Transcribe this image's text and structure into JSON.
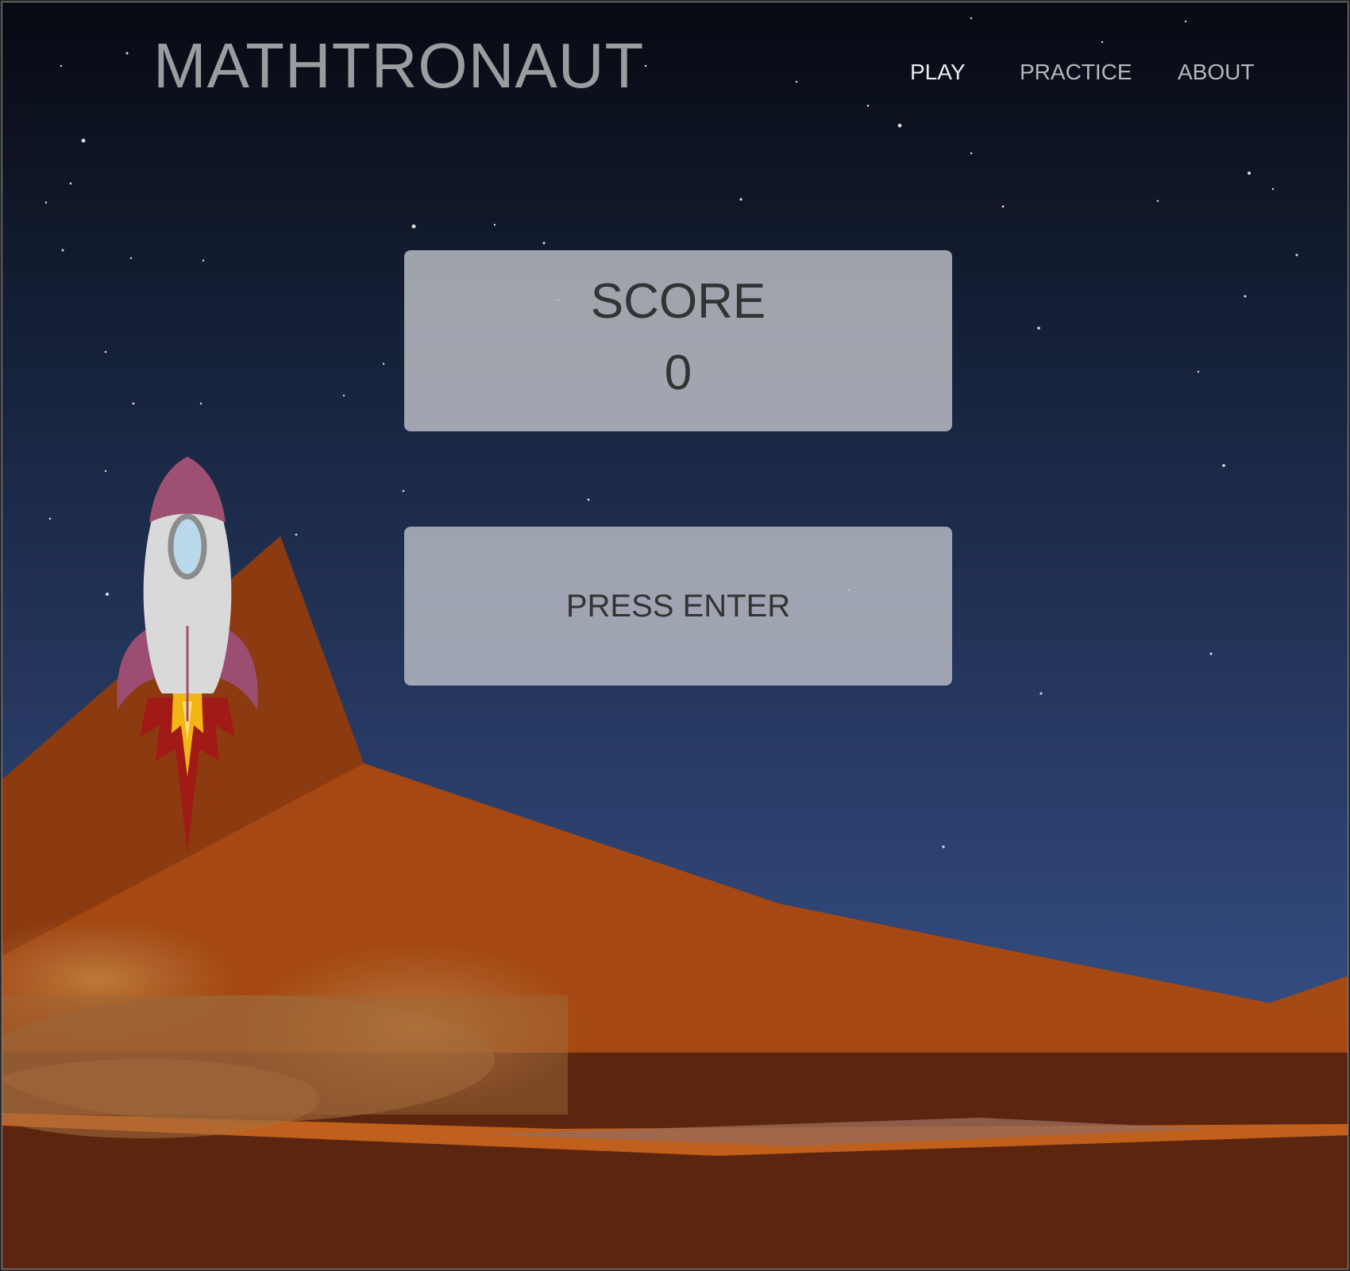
{
  "header": {
    "logo": "MATHTRONAUT",
    "nav": [
      {
        "label": "PLAY",
        "active": true
      },
      {
        "label": "PRACTICE",
        "active": false
      },
      {
        "label": "ABOUT",
        "active": false
      }
    ]
  },
  "score": {
    "label": "SCORE",
    "value": "0"
  },
  "start": {
    "label": "PRESS ENTER"
  },
  "colors": {
    "sky_top": "#070a12",
    "sky_bottom": "#3d5a9a",
    "mountain_light": "#b65a2a",
    "mountain_mid": "#a44a14",
    "ground": "#5b250f",
    "rocket_body": "#d8d8d8",
    "rocket_accent": "#9d4f70",
    "flame_outer": "#a01818",
    "flame_inner": "#f0b010"
  }
}
